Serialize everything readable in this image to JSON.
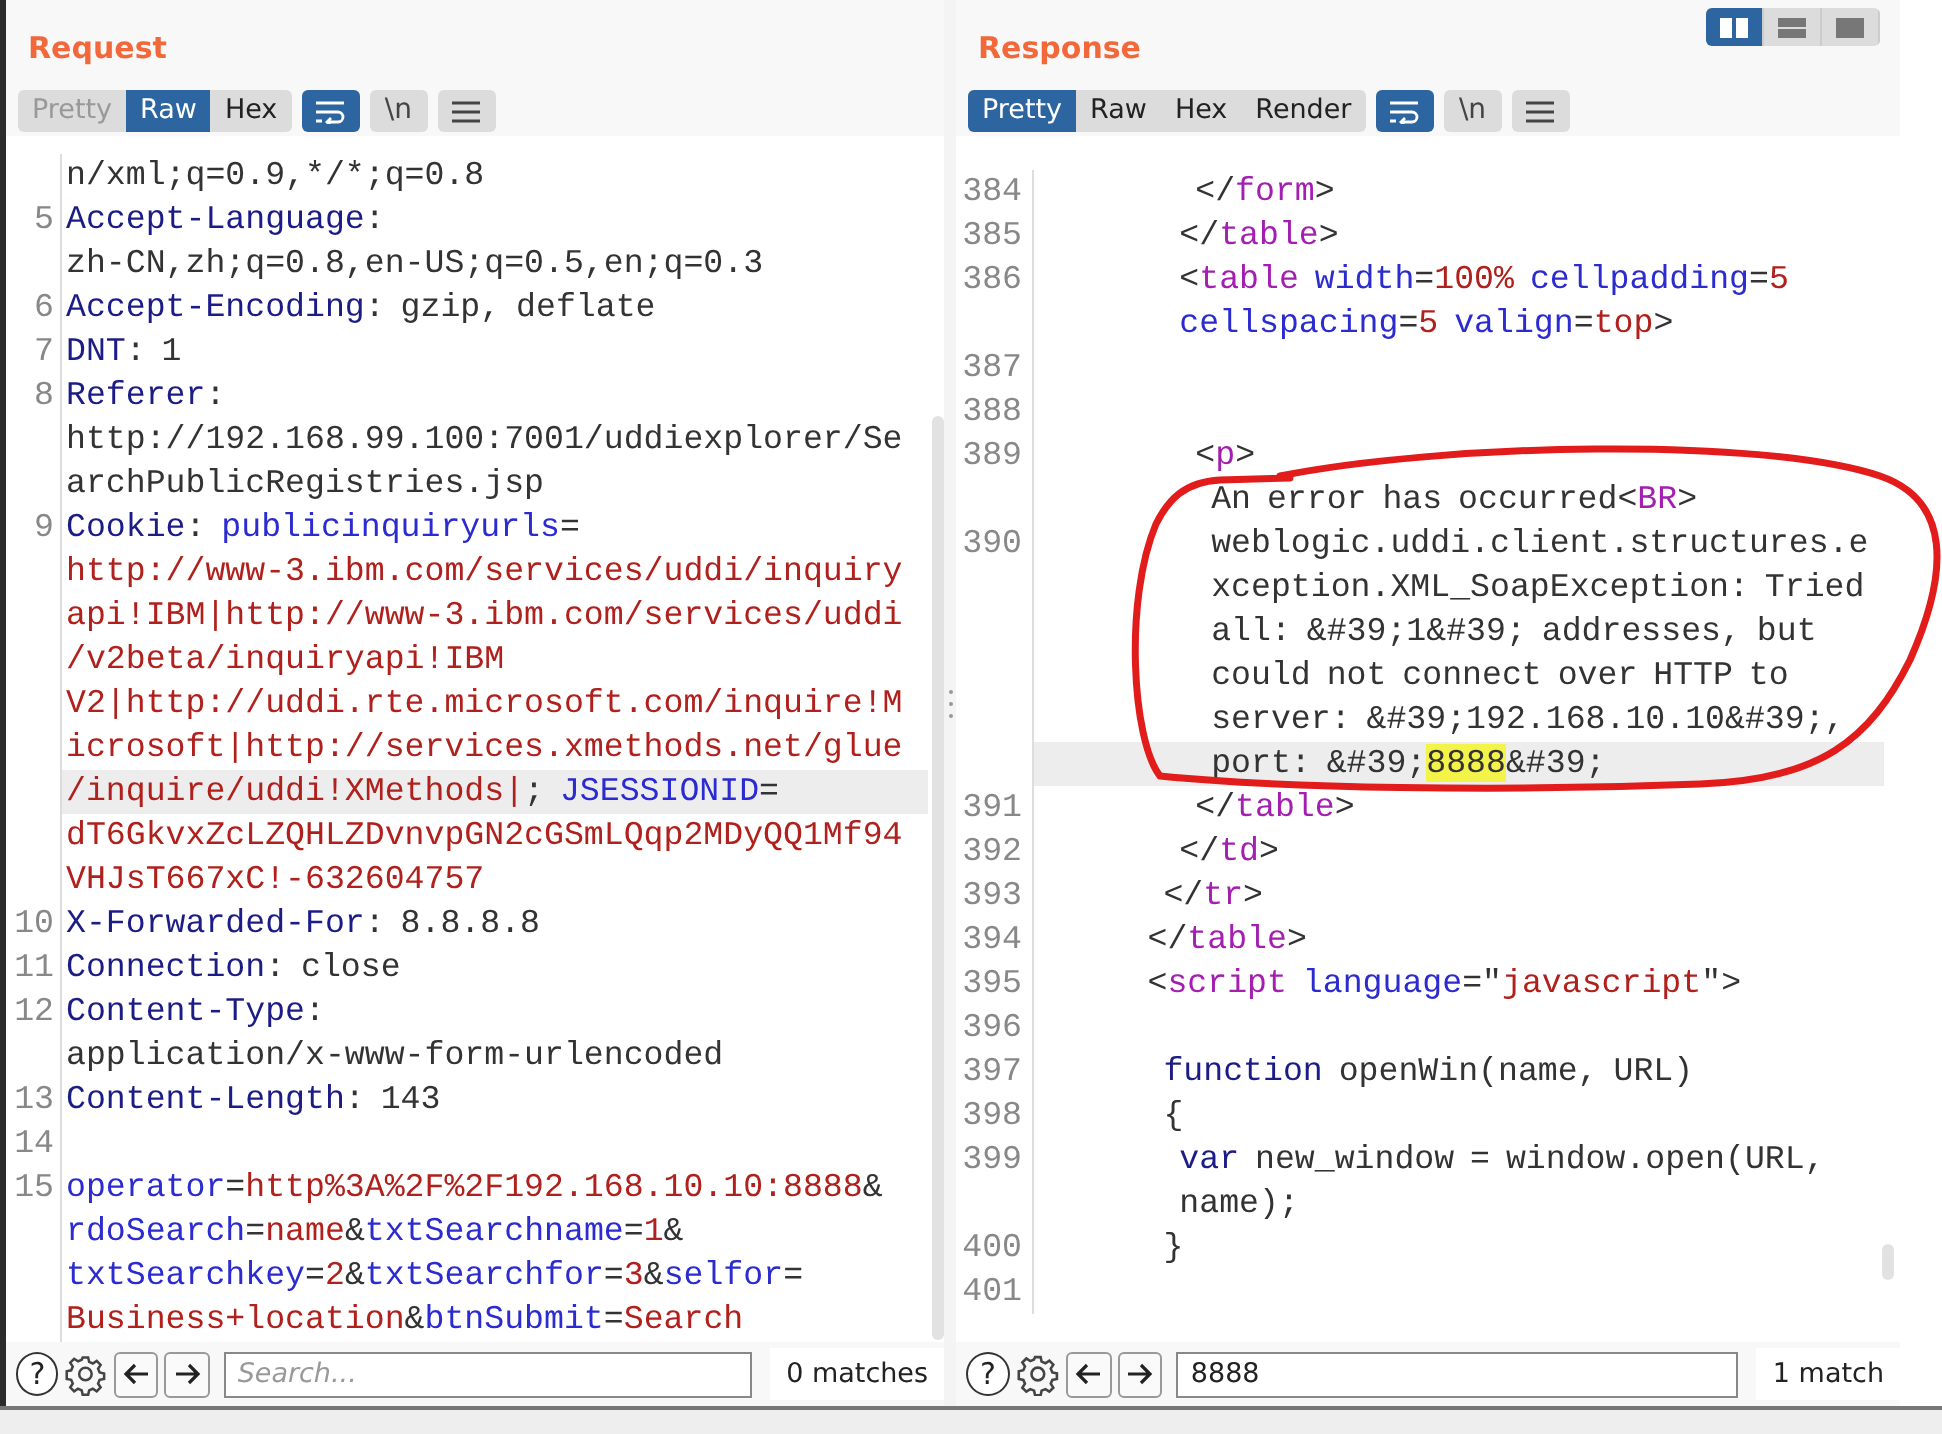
{
  "layout_toggle": [
    {
      "kind": "split",
      "selected": true
    },
    {
      "kind": "stacked",
      "selected": false
    },
    {
      "kind": "single",
      "selected": false
    }
  ],
  "panes": [
    {
      "title": "Request",
      "view_tabs": [
        {
          "label": "Pretty",
          "selected": false,
          "disabled": true
        },
        {
          "label": "Raw",
          "selected": true,
          "disabled": false
        },
        {
          "label": "Hex",
          "selected": false,
          "disabled": false
        }
      ],
      "tools": [
        {
          "kind": "wrap",
          "on": true
        },
        {
          "kind": "newline",
          "label": "\\n",
          "on": false
        },
        {
          "kind": "menu",
          "on": false
        }
      ],
      "lines": [
        {
          "rows": [
            {
              "highlighted": false,
              "segments": [
                {
                  "kind": "plain",
                  "text": "n/xml;q=0.9,*/*;q=0.8"
                }
              ]
            }
          ]
        },
        {
          "number": "5",
          "rows": [
            {
              "highlighted": false,
              "segments": [
                {
                  "kind": "name",
                  "text": "Accept-Language"
                },
                {
                  "kind": "plain",
                  "text": ":"
                }
              ]
            },
            {
              "highlighted": false,
              "segments": [
                {
                  "kind": "plain",
                  "text": "zh-CN,zh;q=0.8,en-US;q=0.5,en;q=0.3"
                }
              ]
            }
          ]
        },
        {
          "number": "6",
          "rows": [
            {
              "highlighted": false,
              "segments": [
                {
                  "kind": "name",
                  "text": "Accept-Encoding"
                },
                {
                  "kind": "plain",
                  "text": ": gzip, deflate"
                }
              ]
            }
          ]
        },
        {
          "number": "7",
          "rows": [
            {
              "highlighted": false,
              "segments": [
                {
                  "kind": "name",
                  "text": "DNT"
                },
                {
                  "kind": "plain",
                  "text": ": 1"
                }
              ]
            }
          ]
        },
        {
          "number": "8",
          "rows": [
            {
              "highlighted": false,
              "segments": [
                {
                  "kind": "name",
                  "text": "Referer"
                },
                {
                  "kind": "plain",
                  "text": ":"
                }
              ]
            },
            {
              "highlighted": false,
              "segments": [
                {
                  "kind": "plain",
                  "text": "http://192.168.99.100:7001/uddiexplorer/Se"
                }
              ]
            },
            {
              "highlighted": false,
              "segments": [
                {
                  "kind": "plain",
                  "text": "archPublicRegistries.jsp"
                }
              ]
            }
          ]
        },
        {
          "number": "9",
          "rows": [
            {
              "highlighted": false,
              "segments": [
                {
                  "kind": "name",
                  "text": "Cookie"
                },
                {
                  "kind": "plain",
                  "text": ": "
                },
                {
                  "kind": "key",
                  "text": "publicinquiryurls"
                },
                {
                  "kind": "plain",
                  "text": "="
                }
              ]
            },
            {
              "highlighted": false,
              "segments": [
                {
                  "kind": "value",
                  "text": "http://www-3.ibm.com/services/uddi/inquiry"
                }
              ]
            },
            {
              "highlighted": false,
              "segments": [
                {
                  "kind": "value",
                  "text": "api!IBM|http://www-3.ibm.com/services/uddi"
                }
              ]
            },
            {
              "highlighted": false,
              "segments": [
                {
                  "kind": "value",
                  "text": "/v2beta/inquiryapi!IBM"
                }
              ]
            },
            {
              "highlighted": false,
              "segments": [
                {
                  "kind": "value",
                  "text": "V2|http://uddi.rte.microsoft.com/inquire!M"
                }
              ]
            },
            {
              "highlighted": false,
              "segments": [
                {
                  "kind": "value",
                  "text": "icrosoft|http://services.xmethods.net/glue"
                }
              ]
            },
            {
              "highlighted": true,
              "segments": [
                {
                  "kind": "value",
                  "text": "/inquire/uddi!XMethods|"
                },
                {
                  "kind": "plain",
                  "text": "; "
                },
                {
                  "kind": "key",
                  "text": "JSESSIONID"
                },
                {
                  "kind": "plain",
                  "text": "="
                }
              ]
            },
            {
              "highlighted": false,
              "segments": [
                {
                  "kind": "value",
                  "text": "dT6GkvxZcLZQHLZDvnvpGN2cGSmLQqp2MDyQQ1Mf94"
                }
              ]
            },
            {
              "highlighted": false,
              "segments": [
                {
                  "kind": "value",
                  "text": "VHJsT667xC!-632604757"
                }
              ]
            }
          ]
        },
        {
          "number": "10",
          "rows": [
            {
              "highlighted": false,
              "segments": [
                {
                  "kind": "name",
                  "text": "X-Forwarded-For"
                },
                {
                  "kind": "plain",
                  "text": ": 8.8.8.8"
                }
              ]
            }
          ]
        },
        {
          "number": "11",
          "rows": [
            {
              "highlighted": false,
              "segments": [
                {
                  "kind": "name",
                  "text": "Connection"
                },
                {
                  "kind": "plain",
                  "text": ": close"
                }
              ]
            }
          ]
        },
        {
          "number": "12",
          "rows": [
            {
              "highlighted": false,
              "segments": [
                {
                  "kind": "name",
                  "text": "Content-Type"
                },
                {
                  "kind": "plain",
                  "text": ":"
                }
              ]
            },
            {
              "highlighted": false,
              "segments": [
                {
                  "kind": "plain",
                  "text": "application/x-www-form-urlencoded"
                }
              ]
            }
          ]
        },
        {
          "number": "13",
          "rows": [
            {
              "highlighted": false,
              "segments": [
                {
                  "kind": "name",
                  "text": "Content-Length"
                },
                {
                  "kind": "plain",
                  "text": ": 143"
                }
              ]
            }
          ]
        },
        {
          "number": "14"
        },
        {
          "number": "15",
          "rows": [
            {
              "highlighted": false,
              "segments": [
                {
                  "kind": "key",
                  "text": "operator"
                },
                {
                  "kind": "plain",
                  "text": "="
                },
                {
                  "kind": "value",
                  "text": "http%3A%2F%2F192.168.10.10:8888"
                },
                {
                  "kind": "plain",
                  "text": "&"
                }
              ]
            },
            {
              "highlighted": false,
              "segments": [
                {
                  "kind": "key",
                  "text": "rdoSearch"
                },
                {
                  "kind": "plain",
                  "text": "="
                },
                {
                  "kind": "value",
                  "text": "name"
                },
                {
                  "kind": "plain",
                  "text": "&"
                },
                {
                  "kind": "key",
                  "text": "txtSearchname"
                },
                {
                  "kind": "plain",
                  "text": "="
                },
                {
                  "kind": "value",
                  "text": "1"
                },
                {
                  "kind": "plain",
                  "text": "&"
                }
              ]
            },
            {
              "highlighted": false,
              "segments": [
                {
                  "kind": "key",
                  "text": "txtSearchkey"
                },
                {
                  "kind": "plain",
                  "text": "="
                },
                {
                  "kind": "value",
                  "text": "2"
                },
                {
                  "kind": "plain",
                  "text": "&"
                },
                {
                  "kind": "key",
                  "text": "txtSearchfor"
                },
                {
                  "kind": "plain",
                  "text": "="
                },
                {
                  "kind": "value",
                  "text": "3"
                },
                {
                  "kind": "plain",
                  "text": "&"
                },
                {
                  "kind": "key",
                  "text": "selfor"
                },
                {
                  "kind": "plain",
                  "text": "="
                }
              ]
            },
            {
              "highlighted": false,
              "segments": [
                {
                  "kind": "value",
                  "text": "Business+location"
                },
                {
                  "kind": "plain",
                  "text": "&"
                },
                {
                  "kind": "key",
                  "text": "btnSubmit"
                },
                {
                  "kind": "plain",
                  "text": "="
                },
                {
                  "kind": "value",
                  "text": "Search"
                }
              ]
            }
          ]
        }
      ],
      "search": {
        "help": "?",
        "placeholder": "Search...",
        "matches": "0 matches"
      }
    },
    {
      "title": "Response",
      "view_tabs": [
        {
          "label": "Pretty",
          "selected": true,
          "disabled": false
        },
        {
          "label": "Raw",
          "selected": false,
          "disabled": false
        },
        {
          "label": "Hex",
          "selected": false,
          "disabled": false
        },
        {
          "label": "Render",
          "selected": false,
          "disabled": false
        }
      ],
      "tools": [
        {
          "kind": "wrap",
          "on": true
        },
        {
          "kind": "newline",
          "label": "\\n",
          "on": false
        },
        {
          "kind": "menu",
          "on": false
        }
      ],
      "lines": [
        {
          "number": "384",
          "rows": [
            {
              "highlighted": false,
              "segments": [
                {
                  "kind": "plain",
                  "text": "         </"
                },
                {
                  "kind": "tag",
                  "text": "form"
                },
                {
                  "kind": "plain",
                  "text": ">"
                }
              ]
            }
          ]
        },
        {
          "number": "385",
          "rows": [
            {
              "highlighted": false,
              "segments": [
                {
                  "kind": "plain",
                  "text": "        </"
                },
                {
                  "kind": "tag",
                  "text": "table"
                },
                {
                  "kind": "plain",
                  "text": ">"
                }
              ]
            }
          ]
        },
        {
          "number": "386",
          "rows": [
            {
              "highlighted": false,
              "segments": [
                {
                  "kind": "plain",
                  "text": "        <"
                },
                {
                  "kind": "tag",
                  "text": "table"
                },
                {
                  "kind": "attr",
                  "text": " width"
                },
                {
                  "kind": "plain",
                  "text": "="
                },
                {
                  "kind": "value",
                  "text": "100%"
                },
                {
                  "kind": "attr",
                  "text": " cellpadding"
                },
                {
                  "kind": "plain",
                  "text": "="
                },
                {
                  "kind": "value",
                  "text": "5"
                }
              ]
            },
            {
              "highlighted": false,
              "segments": [
                {
                  "kind": "attr",
                  "text": "        cellspacing"
                },
                {
                  "kind": "plain",
                  "text": "="
                },
                {
                  "kind": "value",
                  "text": "5"
                },
                {
                  "kind": "attr",
                  "text": " valign"
                },
                {
                  "kind": "plain",
                  "text": "="
                },
                {
                  "kind": "value",
                  "text": "top"
                },
                {
                  "kind": "plain",
                  "text": ">"
                }
              ]
            }
          ]
        },
        {
          "number": "387"
        },
        {
          "number": "388"
        },
        {
          "number": "389",
          "rows": [
            {
              "highlighted": false,
              "segments": [
                {
                  "kind": "plain",
                  "text": "         <"
                },
                {
                  "kind": "tag",
                  "text": "p"
                },
                {
                  "kind": "plain",
                  "text": ">"
                }
              ]
            },
            {
              "highlighted": false,
              "segments": [
                {
                  "kind": "plain",
                  "text": "          An error has occurred<"
                },
                {
                  "kind": "tag",
                  "text": "BR"
                },
                {
                  "kind": "plain",
                  "text": ">"
                }
              ]
            }
          ]
        },
        {
          "number": "390",
          "rows": [
            {
              "highlighted": false,
              "segments": [
                {
                  "kind": "plain",
                  "text": "          weblogic.uddi.client.structures.e"
                }
              ]
            },
            {
              "highlighted": false,
              "segments": [
                {
                  "kind": "plain",
                  "text": "          xception.XML_SoapException: Tried"
                }
              ]
            },
            {
              "highlighted": false,
              "segments": [
                {
                  "kind": "plain",
                  "text": "          all: &#39;1&#39; addresses, but"
                }
              ]
            },
            {
              "highlighted": false,
              "segments": [
                {
                  "kind": "plain",
                  "text": "          could not connect over HTTP to"
                }
              ]
            },
            {
              "highlighted": false,
              "segments": [
                {
                  "kind": "plain",
                  "text": "          server: &#39;192.168.10.10&#39;,"
                }
              ]
            },
            {
              "highlighted": true,
              "segments": [
                {
                  "kind": "plain",
                  "text": "          port: &#39;"
                },
                {
                  "kind": "match",
                  "text": "8888"
                },
                {
                  "kind": "plain",
                  "text": "&#39;"
                }
              ]
            }
          ]
        },
        {
          "number": "391",
          "rows": [
            {
              "highlighted": false,
              "segments": [
                {
                  "kind": "plain",
                  "text": "         </"
                },
                {
                  "kind": "tag",
                  "text": "table"
                },
                {
                  "kind": "plain",
                  "text": ">"
                }
              ]
            }
          ]
        },
        {
          "number": "392",
          "rows": [
            {
              "highlighted": false,
              "segments": [
                {
                  "kind": "plain",
                  "text": "        </"
                },
                {
                  "kind": "tag",
                  "text": "td"
                },
                {
                  "kind": "plain",
                  "text": ">"
                }
              ]
            }
          ]
        },
        {
          "number": "393",
          "rows": [
            {
              "highlighted": false,
              "segments": [
                {
                  "kind": "plain",
                  "text": "       </"
                },
                {
                  "kind": "tag",
                  "text": "tr"
                },
                {
                  "kind": "plain",
                  "text": ">"
                }
              ]
            }
          ]
        },
        {
          "number": "394",
          "rows": [
            {
              "highlighted": false,
              "segments": [
                {
                  "kind": "plain",
                  "text": "      </"
                },
                {
                  "kind": "tag",
                  "text": "table"
                },
                {
                  "kind": "plain",
                  "text": ">"
                }
              ]
            }
          ]
        },
        {
          "number": "395",
          "rows": [
            {
              "highlighted": false,
              "segments": [
                {
                  "kind": "plain",
                  "text": "      <"
                },
                {
                  "kind": "tag",
                  "text": "script"
                },
                {
                  "kind": "attr",
                  "text": " language"
                },
                {
                  "kind": "plain",
                  "text": "=\""
                },
                {
                  "kind": "value",
                  "text": "javascript"
                },
                {
                  "kind": "plain",
                  "text": "\">"
                }
              ]
            }
          ]
        },
        {
          "number": "396"
        },
        {
          "number": "397",
          "rows": [
            {
              "highlighted": false,
              "segments": [
                {
                  "kind": "keyword",
                  "text": "       function"
                },
                {
                  "kind": "plain",
                  "text": " openWin(name, URL)"
                }
              ]
            }
          ]
        },
        {
          "number": "398",
          "rows": [
            {
              "highlighted": false,
              "segments": [
                {
                  "kind": "plain",
                  "text": "       {"
                }
              ]
            }
          ]
        },
        {
          "number": "399",
          "rows": [
            {
              "highlighted": false,
              "segments": [
                {
                  "kind": "keyword",
                  "text": "        var"
                },
                {
                  "kind": "plain",
                  "text": " new_window = window.open(URL,"
                }
              ]
            },
            {
              "highlighted": false,
              "segments": [
                {
                  "kind": "plain",
                  "text": "        name);"
                }
              ]
            }
          ]
        },
        {
          "number": "400",
          "rows": [
            {
              "highlighted": false,
              "segments": [
                {
                  "kind": "plain",
                  "text": "       }"
                }
              ]
            }
          ]
        },
        {
          "number": "401"
        }
      ],
      "search": {
        "help": "?",
        "value": "8888",
        "matches": "1 match"
      }
    }
  ]
}
